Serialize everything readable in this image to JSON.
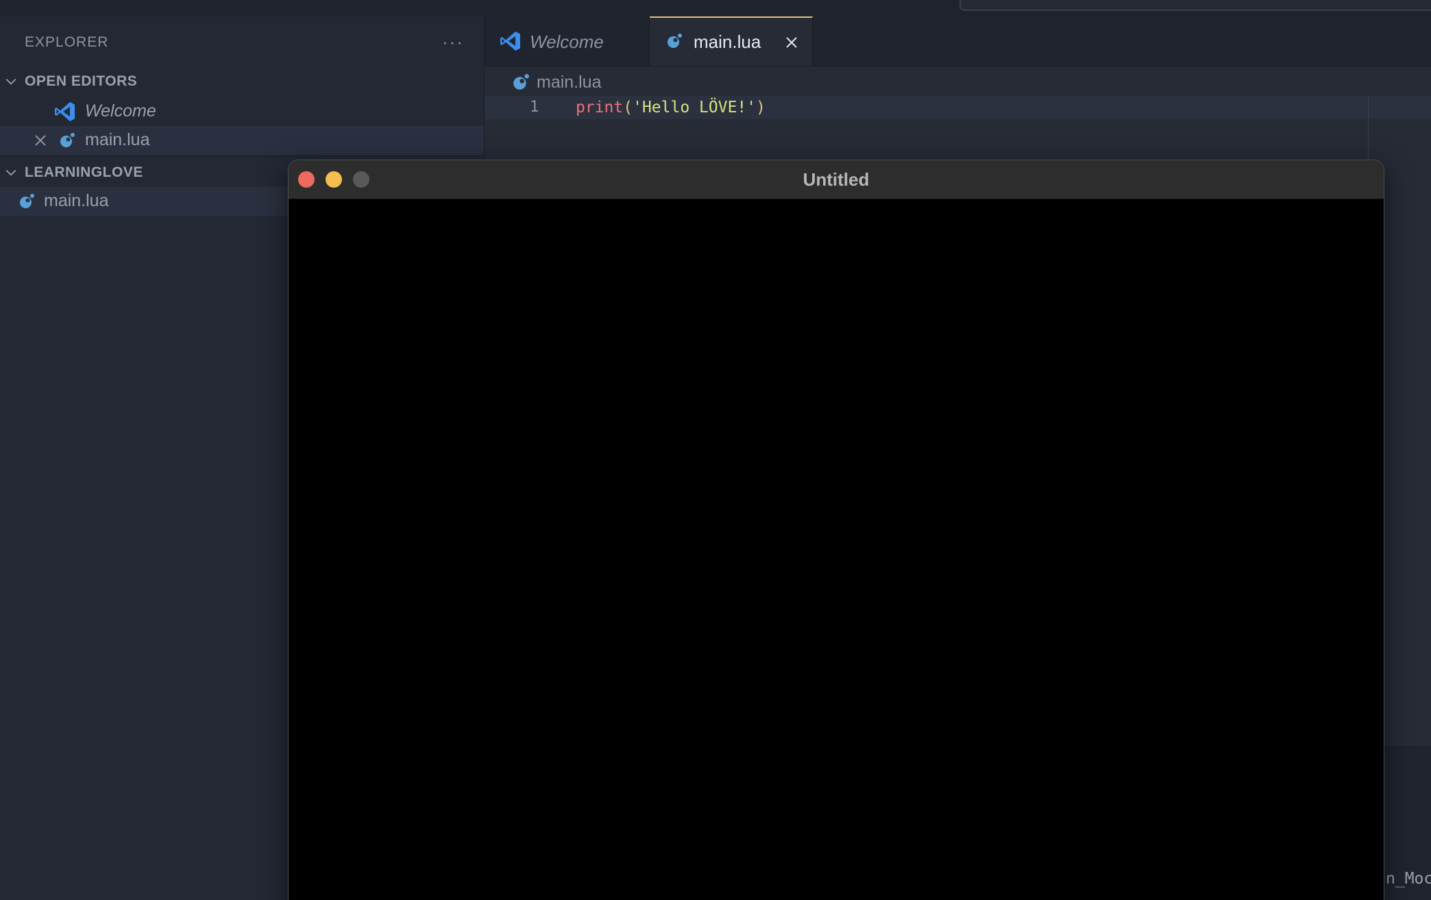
{
  "sidebar": {
    "title": "EXPLORER",
    "more_icon": "ellipsis-icon",
    "open_editors": {
      "label": "OPEN EDITORS",
      "items": [
        {
          "label": "Welcome",
          "icon": "vscode-icon"
        },
        {
          "label": "main.lua",
          "icon": "lua-icon"
        }
      ]
    },
    "folder": {
      "label": "LEARNINGLOVE",
      "items": [
        {
          "label": "main.lua",
          "icon": "lua-icon"
        }
      ]
    }
  },
  "tabs": [
    {
      "label": "Welcome",
      "icon": "vscode-icon",
      "active": false
    },
    {
      "label": "main.lua",
      "icon": "lua-icon",
      "active": true
    }
  ],
  "editor": {
    "breadcrumb": "main.lua",
    "line_number": "1",
    "code": {
      "fn": "print",
      "open": "(",
      "string": "'Hello LÖVE!'",
      "close": ")"
    }
  },
  "panel": {
    "visible_text": "n_Moc"
  },
  "window": {
    "title": "Untitled",
    "buttons": [
      "close",
      "minimize",
      "maximize"
    ]
  },
  "colors": {
    "accent_tab_border": "#e5c07b",
    "lua_icon": "#5aa0d8",
    "vscode_icon": "#3b8eea"
  }
}
